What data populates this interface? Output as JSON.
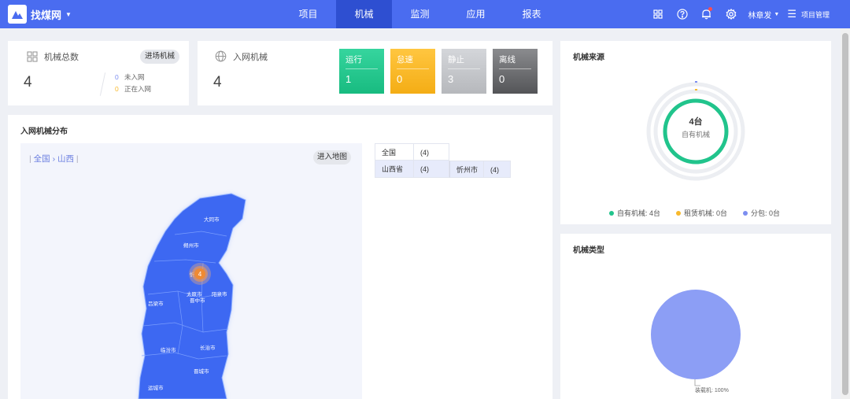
{
  "app": {
    "name": "找煤网"
  },
  "nav": [
    {
      "label": "项目"
    },
    {
      "label": "机械"
    },
    {
      "label": "监测"
    },
    {
      "label": "应用"
    },
    {
      "label": "报表"
    }
  ],
  "user": {
    "name": "林章发",
    "project_manage": "项目管理"
  },
  "colors": {
    "topbar": "#4a6cf0",
    "active_nav": "#2e4fd1",
    "running": "#22c98f",
    "idle": "#f8b92c",
    "stopped": "#c6c8cc",
    "offline": "#6a6b6e",
    "own": "#22c98f",
    "rent": "#f8b92c",
    "sub": "#7c8ef0"
  },
  "summary": {
    "title": "机械总数",
    "button": "进场机械",
    "total": "4",
    "not_in_count": "0",
    "not_in_label": "未入网",
    "entering_count": "0",
    "entering_label": "正在入网"
  },
  "network": {
    "title": "入网机械",
    "total": "4",
    "tiles": [
      {
        "label": "运行",
        "value": "1"
      },
      {
        "label": "怠速",
        "value": "0"
      },
      {
        "label": "静止",
        "value": "3"
      },
      {
        "label": "离线",
        "value": "0"
      }
    ]
  },
  "distribution": {
    "title": "入网机械分布",
    "breadcrumb_all": "全国",
    "breadcrumb_sep": "›",
    "breadcrumb_current": "山西",
    "enter_map": "进入地图",
    "marker_count": "4",
    "cities": [
      "大同市",
      "朔州市",
      "忻州市",
      "太原市",
      "阳泉市",
      "晋中市",
      "吕梁市",
      "临汾市",
      "长治市",
      "晋城市",
      "运城市"
    ],
    "table": [
      {
        "name": "全国",
        "count": "(4)"
      },
      {
        "name": "山西省",
        "count": "(4)"
      },
      {
        "name": "忻州市",
        "count": "(4)"
      }
    ]
  },
  "source": {
    "title": "机械来源",
    "center_value": "4台",
    "center_label": "自有机械",
    "legend": [
      {
        "label": "自有机械: 4台"
      },
      {
        "label": "租赁机械: 0台"
      },
      {
        "label": "分包: 0台"
      }
    ]
  },
  "type": {
    "title": "机械类型",
    "slice_label": "装载机: 100%",
    "slice_share": 1.0
  }
}
